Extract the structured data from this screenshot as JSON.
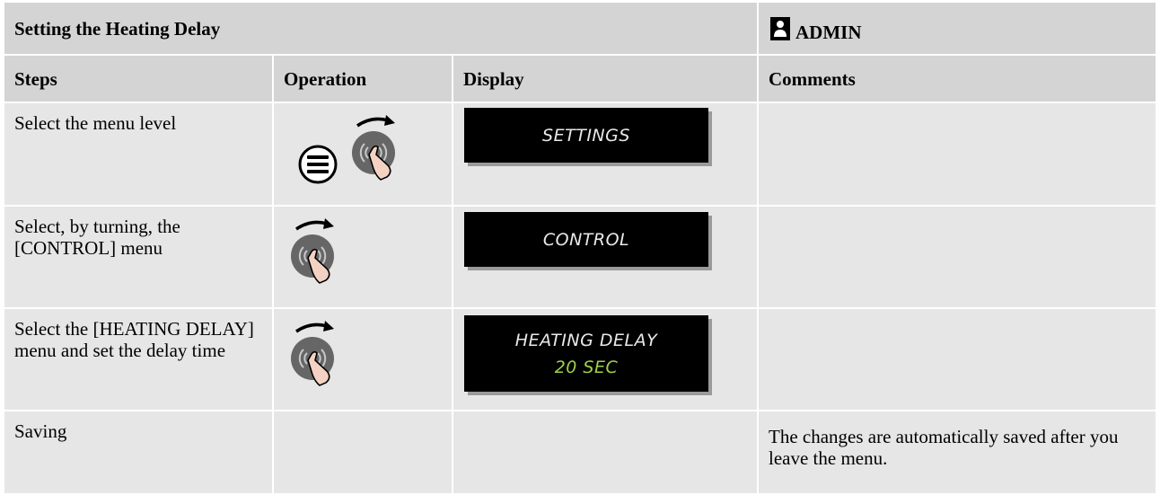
{
  "header": {
    "title": "Setting the Heating Delay",
    "role": "ADMIN"
  },
  "columns": [
    "Steps",
    "Operation",
    "Display",
    "Comments"
  ],
  "rows": [
    {
      "step": "Select the menu level",
      "operation_icons": [
        "menu-button-icon",
        "turn-knob-icon"
      ],
      "display_lines": [
        "SETTINGS"
      ],
      "comment": ""
    },
    {
      "step": "Select, by turning, the [CONTROL] menu",
      "operation_icons": [
        "turn-knob-icon"
      ],
      "display_lines": [
        "CONTROL"
      ],
      "comment": ""
    },
    {
      "step": "Select the [HEATING DELAY] menu and set the delay time",
      "operation_icons": [
        "turn-knob-icon"
      ],
      "display_lines": [
        "HEATING DELAY",
        "20 SEC"
      ],
      "comment": ""
    },
    {
      "step": "Saving",
      "operation_icons": [],
      "display_lines": [],
      "comment": "The changes are automatically saved after you leave the menu."
    }
  ],
  "colors": {
    "header_bg": "#d4d4d4",
    "cell_bg": "#e6e6e6",
    "lcd_bg": "#000000",
    "lcd_text": "#e9e9e9",
    "lcd_value": "#9fd04a"
  }
}
